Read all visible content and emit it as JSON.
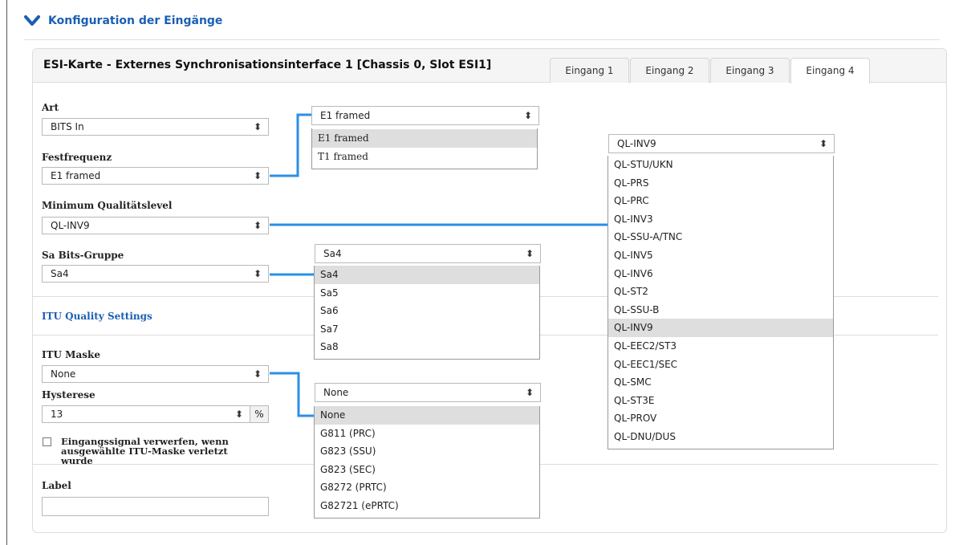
{
  "section": {
    "title": "Konfiguration der Eingänge"
  },
  "panel": {
    "title": "ESI-Karte - Externes Synchronisationsinterface 1 [Chassis 0, Slot ESI1]",
    "tabs": [
      "Eingang 1",
      "Eingang 2",
      "Eingang 3",
      "Eingang 4"
    ],
    "active_tab": "Eingang 4"
  },
  "fields": {
    "art": {
      "label": "Art",
      "value": "BITS In"
    },
    "festfrequenz": {
      "label": "Festfrequenz",
      "value": "E1 framed"
    },
    "min_ql": {
      "label": "Minimum Qualitätslevel",
      "value": "QL-INV9"
    },
    "sa_bits": {
      "label": "Sa Bits-Gruppe",
      "value": "Sa4"
    },
    "itu_settings_link": "ITU Quality Settings",
    "itu_maske": {
      "label": "ITU Maske",
      "value": "None"
    },
    "hysterese": {
      "label": "Hysterese",
      "value": "13",
      "unit": "%"
    },
    "discard_checkbox": {
      "label": "Eingangssignal verwerfen, wenn ausgewählte ITU-Maske verletzt wurde",
      "checked": false
    },
    "label_field": {
      "label": "Label",
      "value": ""
    }
  },
  "dropdowns": {
    "festfrequenz": {
      "selected": "E1 framed",
      "options": [
        "E1 framed",
        "T1 framed"
      ]
    },
    "qualitaetslevel": {
      "selected": "QL-INV9",
      "options": [
        "QL-STU/UKN",
        "QL-PRS",
        "QL-PRC",
        "QL-INV3",
        "QL-SSU-A/TNC",
        "QL-INV5",
        "QL-INV6",
        "QL-ST2",
        "QL-SSU-B",
        "QL-INV9",
        "QL-EEC2/ST3",
        "QL-EEC1/SEC",
        "QL-SMC",
        "QL-ST3E",
        "QL-PROV",
        "QL-DNU/DUS"
      ]
    },
    "sa_bits": {
      "selected": "Sa4",
      "options": [
        "Sa4",
        "Sa5",
        "Sa6",
        "Sa7",
        "Sa8"
      ]
    },
    "itu_maske": {
      "selected": "None",
      "options": [
        "None",
        "G811 (PRC)",
        "G823 (SSU)",
        "G823 (SEC)",
        "G8272 (PRTC)",
        "G82721 (ePRTC)"
      ]
    }
  },
  "icons": {
    "collapse": "chevron-down-icon",
    "select_arrows": "sort-arrows-icon"
  },
  "colors": {
    "accent": "#1a5fb4",
    "connector": "#2b8fe6",
    "highlight": "#dedede"
  }
}
